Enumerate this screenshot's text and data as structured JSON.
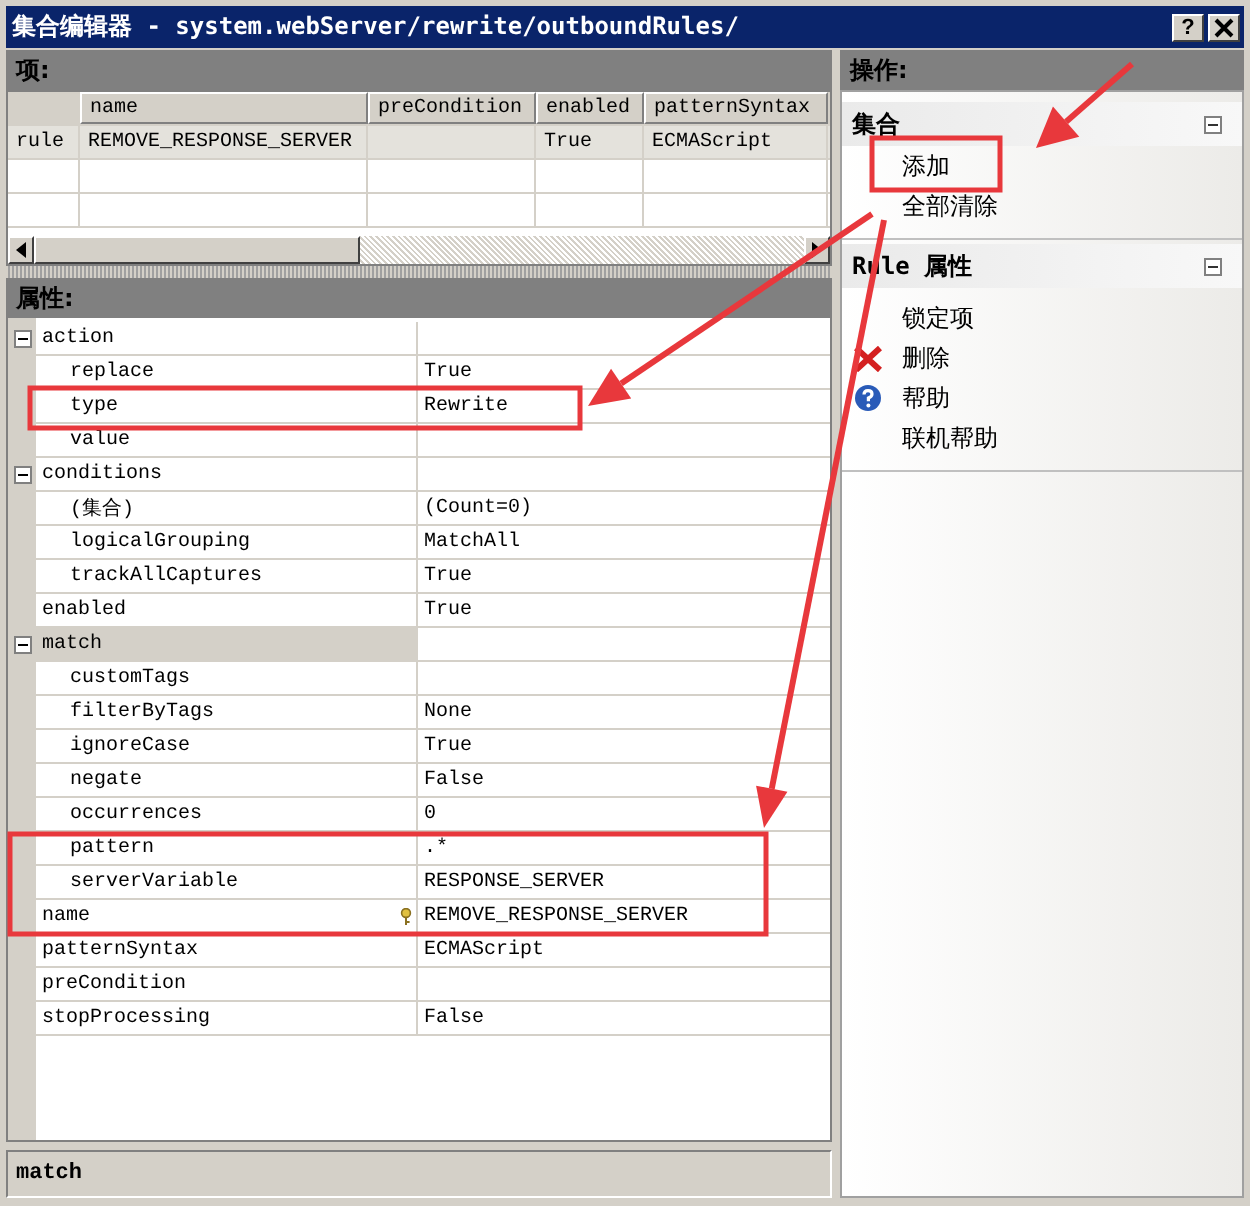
{
  "window": {
    "title": "集合编辑器 - system.webServer/rewrite/outboundRules/",
    "help_button": "?"
  },
  "items_panel": {
    "title": "项:",
    "columns": [
      "name",
      "preCondition",
      "enabled",
      "patternSyntax"
    ],
    "rows": [
      {
        "label": "rule",
        "selected": true,
        "cells": [
          "REMOVE_RESPONSE_SERVER",
          null,
          "True",
          "ECMAScript"
        ]
      }
    ]
  },
  "properties_panel": {
    "title": "属性:",
    "items": [
      {
        "name": "action",
        "kind": "group",
        "expanded": true,
        "selected": false,
        "children": [
          {
            "name": "replace",
            "value": "True",
            "kind": "property",
            "selected": false
          },
          {
            "name": "type",
            "value": "Rewrite",
            "kind": "property",
            "selected": false
          },
          {
            "name": "value",
            "kind": "property",
            "selected": false
          }
        ]
      },
      {
        "name": "conditions",
        "kind": "group",
        "expanded": true,
        "selected": false,
        "children": [
          {
            "name": "(集合)",
            "value": "(Count=0)",
            "kind": "property",
            "selected": false
          },
          {
            "name": "logicalGrouping",
            "value": "MatchAll",
            "kind": "property",
            "selected": false
          },
          {
            "name": "trackAllCaptures",
            "value": "True",
            "kind": "property",
            "selected": false
          }
        ]
      },
      {
        "name": "enabled",
        "value": "True",
        "kind": "property",
        "selected": false
      },
      {
        "name": "match",
        "kind": "group",
        "expanded": true,
        "selected": true,
        "children": [
          {
            "name": "customTags",
            "kind": "property",
            "selected": false
          },
          {
            "name": "filterByTags",
            "value": "None",
            "kind": "property",
            "selected": false
          },
          {
            "name": "ignoreCase",
            "value": "True",
            "kind": "property",
            "selected": false
          },
          {
            "name": "negate",
            "value": "False",
            "kind": "property",
            "selected": false
          },
          {
            "name": "occurrences",
            "value": "0",
            "kind": "property",
            "selected": false
          },
          {
            "name": "pattern",
            "value": ".*",
            "kind": "property",
            "selected": false
          },
          {
            "name": "serverVariable",
            "value": "RESPONSE_SERVER",
            "kind": "property",
            "selected": false
          }
        ]
      },
      {
        "name": "name",
        "value": "REMOVE_RESPONSE_SERVER",
        "kind": "key",
        "selected": false
      },
      {
        "name": "patternSyntax",
        "value": "ECMAScript",
        "kind": "property",
        "selected": false
      },
      {
        "name": "preCondition",
        "kind": "property",
        "selected": false
      },
      {
        "name": "stopProcessing",
        "value": "False",
        "kind": "property",
        "selected": false
      }
    ],
    "description": "match"
  },
  "actions_panel": {
    "title": "操作:",
    "sections": [
      {
        "title": "集合",
        "expanded": true,
        "items": [
          {
            "label": "添加",
            "kind": "plain"
          },
          {
            "label": "全部清除",
            "kind": "plain"
          }
        ]
      },
      {
        "title": "Rule 属性",
        "expanded": true,
        "items": [
          {
            "label": "锁定项",
            "kind": "plain"
          },
          {
            "label": "删除",
            "kind": "delete"
          },
          {
            "label": "帮助",
            "kind": "help"
          },
          {
            "label": "联机帮助",
            "kind": "plain"
          }
        ]
      }
    ]
  }
}
